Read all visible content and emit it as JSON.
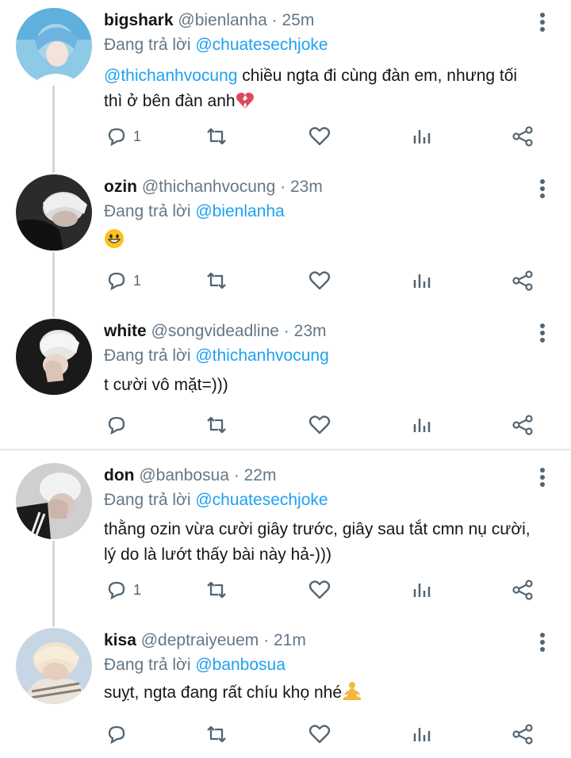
{
  "reply_prefix": "Đang trả lời",
  "tweets": [
    {
      "name": "bigshark",
      "handle": "@bienlanha",
      "time": "25m",
      "reply_to": "@chuatesechjoke",
      "mention": "@thichanhvocung",
      "text_line1": " chiều ngta đi cùng đàn em, nhưng tối",
      "text_line2": "thì ở bên đàn anh",
      "emoji": "broken-heart-icon",
      "reply_count": "1"
    },
    {
      "name": "ozin",
      "handle": "@thichanhvocung",
      "time": "23m",
      "reply_to": "@bienlanha",
      "emoji": "grinning-face-icon",
      "reply_count": "1"
    },
    {
      "name": "white",
      "handle": "@songvideadline",
      "time": "23m",
      "reply_to": "@thichanhvocung",
      "text_line1": "t cười vô mặt=)))",
      "reply_count": ""
    },
    {
      "name": "don",
      "handle": "@banbosua",
      "time": "22m",
      "reply_to": "@chuatesechjoke",
      "text_line1": "thằng ozin vừa cười giây trước, giây sau tắt cmn nụ cười,",
      "text_line2": "lý do là lướt thấy bài này hả-)))",
      "reply_count": "1"
    },
    {
      "name": "kisa",
      "handle": "@deptraiyeuem",
      "time": "21m",
      "reply_to": "@banbosua",
      "text_line1": "suỵt, ngta đang rất chíu khọ nhé",
      "emoji": "person-in-lotus-position-icon",
      "reply_count": ""
    }
  ],
  "separator": "·",
  "colors": {
    "accent": "#1da1f2",
    "muted": "#657786",
    "icon": "#536471",
    "divider": "#e1e8ed"
  }
}
